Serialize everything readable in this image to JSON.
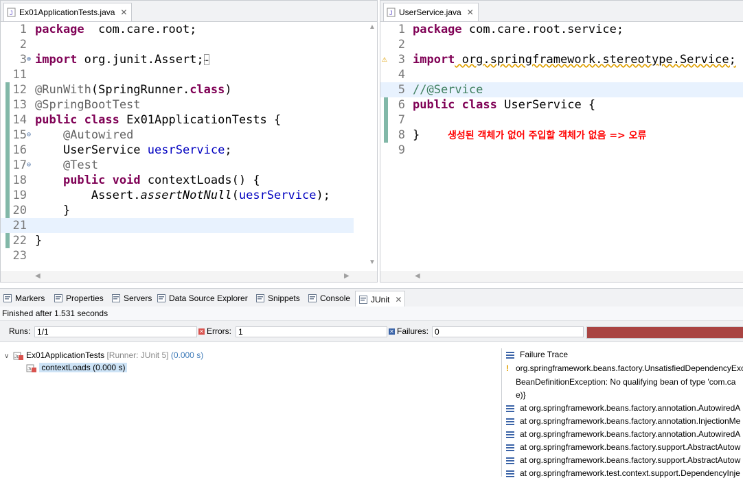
{
  "left_editor": {
    "tab_title": "Ex01ApplicationTests.java",
    "lines": [
      {
        "num": "1",
        "parts": [
          [
            "kw",
            "package"
          ],
          [
            "",
            "  com.care.root;"
          ]
        ]
      },
      {
        "num": "2",
        "parts": []
      },
      {
        "num": "3",
        "fold": "⊕",
        "parts": [
          [
            "kw",
            "import"
          ],
          [
            "",
            " org.junit.Assert;"
          ],
          [
            "box",
            "…"
          ]
        ]
      },
      {
        "num": "11",
        "parts": []
      },
      {
        "num": "12",
        "parts": [
          [
            "ann",
            "@RunWith"
          ],
          [
            "",
            "(SpringRunner."
          ],
          [
            "kw",
            "class"
          ],
          [
            "",
            ")"
          ]
        ]
      },
      {
        "num": "13",
        "parts": [
          [
            "ann",
            "@SpringBootTest"
          ]
        ]
      },
      {
        "num": "14",
        "parts": [
          [
            "kw",
            "public"
          ],
          [
            "",
            " "
          ],
          [
            "kw",
            "class"
          ],
          [
            "",
            " Ex01ApplicationTests {"
          ]
        ]
      },
      {
        "num": "15",
        "fold": "⊖",
        "parts": [
          [
            "",
            "    "
          ],
          [
            "ann",
            "@Autowired"
          ]
        ]
      },
      {
        "num": "16",
        "parts": [
          [
            "",
            "    UserService "
          ],
          [
            "fld",
            "uesrService"
          ],
          [
            "",
            ";"
          ]
        ]
      },
      {
        "num": "17",
        "fold": "⊖",
        "parts": [
          [
            "",
            "    "
          ],
          [
            "ann",
            "@Test"
          ]
        ]
      },
      {
        "num": "18",
        "parts": [
          [
            "",
            "    "
          ],
          [
            "kw",
            "public"
          ],
          [
            "",
            " "
          ],
          [
            "kw",
            "void"
          ],
          [
            "",
            " contextLoads() {"
          ]
        ]
      },
      {
        "num": "19",
        "parts": [
          [
            "",
            "        Assert."
          ],
          [
            "it",
            "assertNotNull"
          ],
          [
            "",
            "("
          ],
          [
            "fld",
            "uesrService"
          ],
          [
            "",
            ");"
          ]
        ]
      },
      {
        "num": "20",
        "parts": [
          [
            "",
            "    }"
          ]
        ]
      },
      {
        "num": "21",
        "parts": [],
        "current": true
      },
      {
        "num": "22",
        "parts": [
          [
            "",
            "}"
          ]
        ]
      },
      {
        "num": "23",
        "parts": []
      }
    ]
  },
  "right_editor": {
    "tab_title": "UserService.java",
    "lines": [
      {
        "num": "1",
        "parts": [
          [
            "kw",
            "package"
          ],
          [
            "",
            " com.care.root.service;"
          ]
        ]
      },
      {
        "num": "2",
        "parts": []
      },
      {
        "num": "3",
        "warn": true,
        "parts": [
          [
            "kw",
            "import"
          ],
          [
            "",
            " org.springframework.stereotype.Service;"
          ]
        ]
      },
      {
        "num": "4",
        "parts": []
      },
      {
        "num": "5",
        "parts": [
          [
            "cmt",
            "//@Service"
          ]
        ],
        "current": true
      },
      {
        "num": "6",
        "parts": [
          [
            "kw",
            "public"
          ],
          [
            "",
            " "
          ],
          [
            "kw",
            "class"
          ],
          [
            "",
            " UserService {"
          ]
        ]
      },
      {
        "num": "7",
        "parts": []
      },
      {
        "num": "8",
        "parts": [
          [
            "",
            "}"
          ]
        ]
      },
      {
        "num": "9",
        "parts": []
      }
    ],
    "annotation_text": "생성된 객체가 없어 주입할 객체가 없음 => 오류",
    "annotation_color": "#ff0000"
  },
  "views": {
    "tabs": [
      {
        "label": "Markers",
        "icon": "markers-icon"
      },
      {
        "label": "Properties",
        "icon": "properties-icon"
      },
      {
        "label": "Servers",
        "icon": "servers-icon"
      },
      {
        "label": "Data Source Explorer",
        "icon": "data-source-icon"
      },
      {
        "label": "Snippets",
        "icon": "snippets-icon"
      },
      {
        "label": "Console",
        "icon": "console-icon"
      },
      {
        "label": "JUnit",
        "icon": "junit-icon",
        "active": true
      }
    ]
  },
  "junit": {
    "status": "Finished after 1.531 seconds",
    "runs_label": "Runs:",
    "runs_value": "1/1",
    "errors_label": "Errors:",
    "errors_value": "1",
    "failures_label": "Failures:",
    "failures_value": "0",
    "progress_color": "#a94442",
    "progress_fraction": 1.0,
    "tree": {
      "root_name": "Ex01ApplicationTests",
      "root_runner": "[Runner: JUnit 5]",
      "root_time": "(0.000 s)",
      "child_name": "contextLoads",
      "child_time": "(0.000 s)"
    },
    "failure_trace_title": "Failure Trace",
    "trace": [
      "org.springframework.beans.factory.UnsatisfiedDependencyExc",
      "BeanDefinitionException: No qualifying bean of type 'com.ca",
      "e)}",
      "at org.springframework.beans.factory.annotation.AutowiredA",
      "at org.springframework.beans.factory.annotation.InjectionMe",
      "at org.springframework.beans.factory.annotation.AutowiredA",
      "at org.springframework.beans.factory.support.AbstractAutow",
      "at org.springframework.beans.factory.support.AbstractAutow",
      "at org.springframework.test.context.support.DependencyInje"
    ]
  }
}
